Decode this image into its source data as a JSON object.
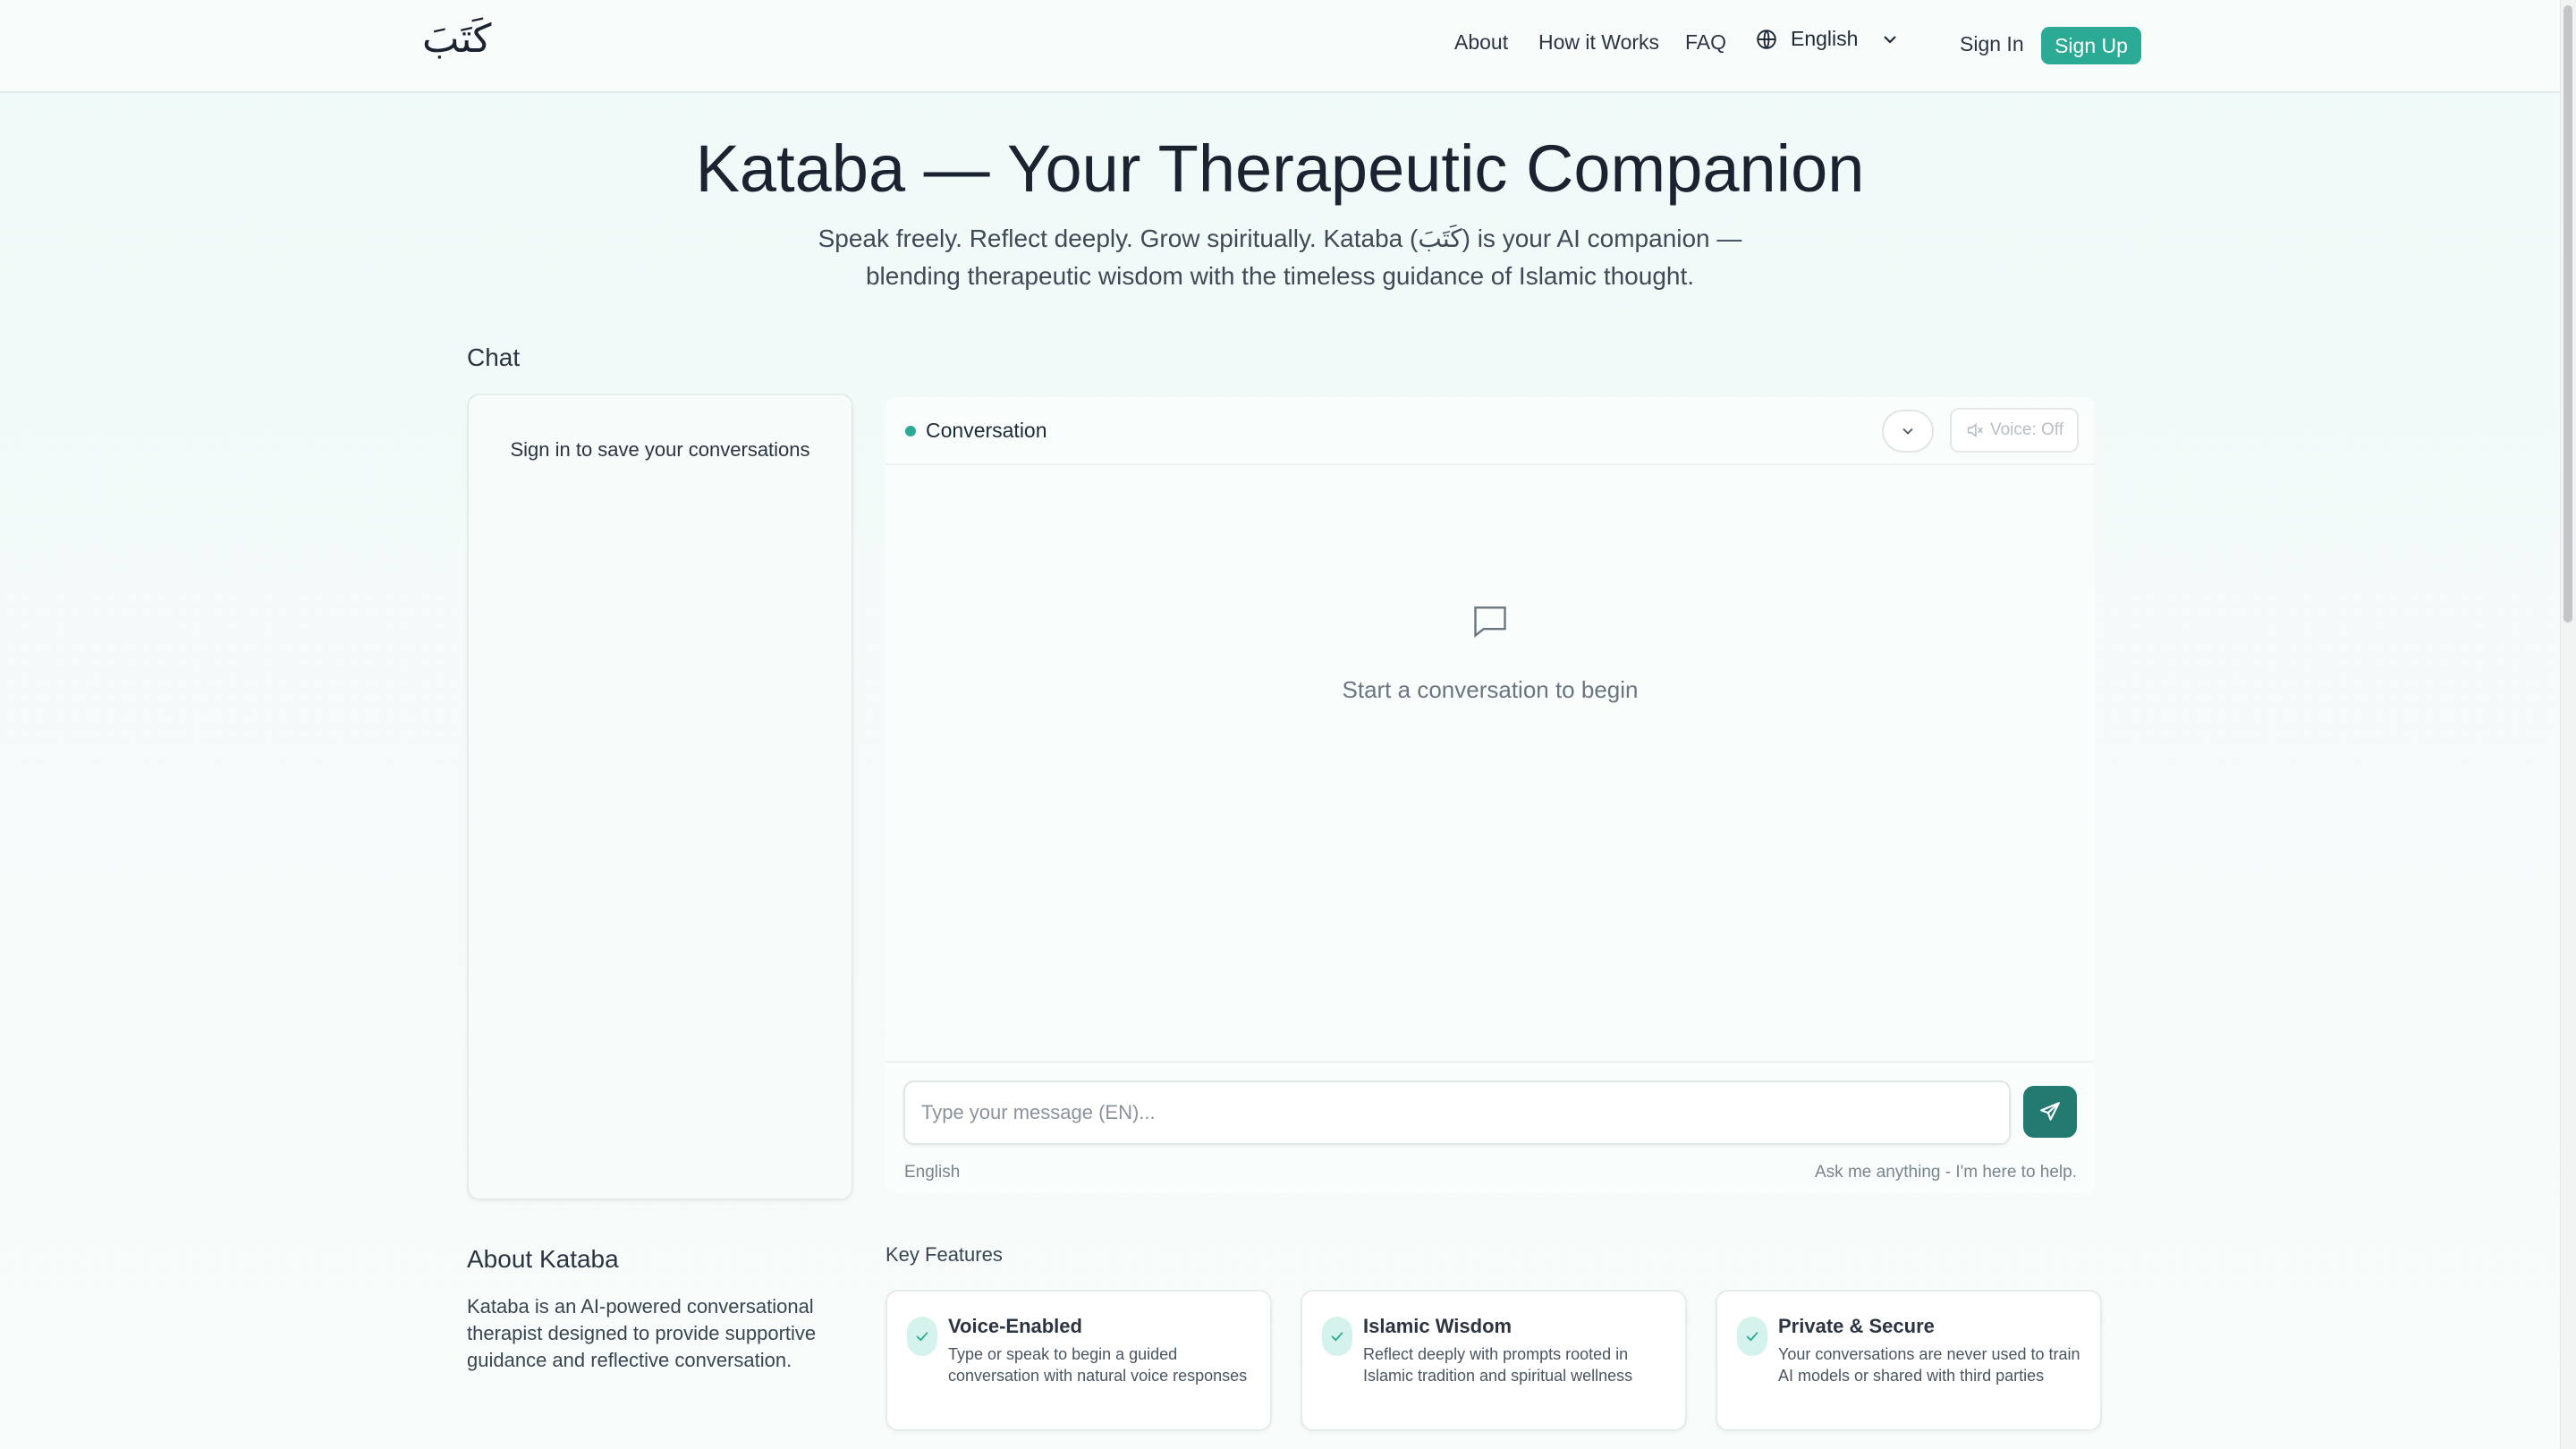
{
  "nav": {
    "logo": "كَتَبَ",
    "links": [
      "About",
      "How it Works",
      "FAQ"
    ],
    "language": "English",
    "sign_in": "Sign In",
    "sign_up": "Sign Up"
  },
  "hero": {
    "title": "Kataba — Your Therapeutic Companion",
    "subtitle_line1": "Speak freely. Reflect deeply. Grow spiritually. Kataba (كَتَبَ) is your AI companion —",
    "subtitle_line2": "blending therapeutic wisdom with the timeless guidance of Islamic thought."
  },
  "chat_section": {
    "heading": "Chat",
    "sidebar_message": "Sign in to save your conversations",
    "conversation_title": "Conversation",
    "voice_label": "Voice: Off",
    "empty_state": "Start a conversation to begin",
    "input_placeholder": "Type your message (EN)...",
    "input_language": "English",
    "input_hint": "Ask me anything - I'm here to help."
  },
  "about": {
    "heading": "About Kataba",
    "text": "Kataba is an AI-powered conversational therapist designed to provide supportive guidance and reflective conversation."
  },
  "features": {
    "heading": "Key Features",
    "items": [
      {
        "title": "Voice-Enabled",
        "desc": "Type or speak to begin a guided conversation with natural voice responses"
      },
      {
        "title": "Islamic Wisdom",
        "desc": "Reflect deeply with prompts rooted in Islamic tradition and spiritual wellness"
      },
      {
        "title": "Private & Secure",
        "desc": "Your conversations are never used to train AI models or shared with third parties"
      }
    ]
  },
  "colors": {
    "accent": "#2bab96",
    "send_button": "#237a70",
    "background": "#f0faf8"
  },
  "icons": [
    "globe-icon",
    "chevron-down-icon",
    "speaker-muted-icon",
    "chat-bubble-icon",
    "send-icon",
    "check-icon"
  ]
}
